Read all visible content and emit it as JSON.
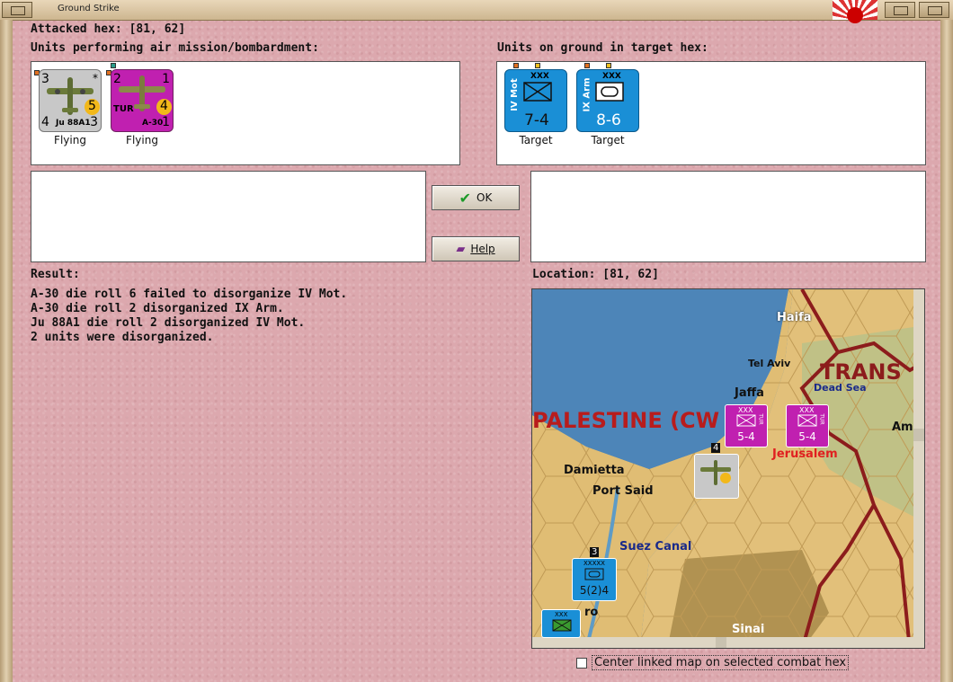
{
  "window": {
    "title": "Ground Strike"
  },
  "attacked_hex": {
    "label": "Attacked hex:",
    "value": "[81, 62]"
  },
  "air_units": {
    "label": "Units performing air mission/bombardment:",
    "units": [
      {
        "name": "Ju 88A1",
        "top_left": "3",
        "strength": "5",
        "bottom_left": "4",
        "bottom_right": "3",
        "star": "*",
        "status": "Flying",
        "color": "#c8c8c8"
      },
      {
        "name": "A-30",
        "nation": "TUR",
        "top_left": "2",
        "top_right": "1",
        "strength": "4",
        "bottom_right": "1",
        "status": "Flying",
        "color": "#c020b0"
      }
    ]
  },
  "ground_units": {
    "label": "Units on ground in target hex:",
    "units": [
      {
        "name": "IV Mot",
        "size": "XXX",
        "values": "7-4",
        "status": "Target",
        "color": "#1a8fd6"
      },
      {
        "name": "IX Arm",
        "size": "XXX",
        "values": "8-6",
        "status": "Target",
        "color": "#1a8fd6"
      }
    ]
  },
  "buttons": {
    "ok": "OK",
    "help": "Help"
  },
  "result": {
    "label": "Result:",
    "lines": [
      "A-30 die roll 6 failed to disorganize IV Mot.",
      "A-30 die roll 2 disorganized IX Arm.",
      "Ju 88A1 die roll 2 disorganized IV Mot.",
      "2 units were disorganized."
    ]
  },
  "location": {
    "label": "Location:",
    "value": "[81, 62]"
  },
  "map": {
    "places": [
      "Haifa",
      "Tel Aviv",
      "Jaffa",
      "Dead Sea",
      "TRANS",
      "Am",
      "PALESTINE (CW",
      "Jerusalem",
      "Damietta",
      "Port Said",
      "Suez Canal",
      "ro",
      "Sinai"
    ],
    "units": [
      {
        "size": "XXX",
        "values": "5-4",
        "nation": "TUR"
      },
      {
        "size": "XXX",
        "values": "5-4",
        "nation": "TUR"
      },
      {
        "size": "XXXXX",
        "values": "5(2)4"
      },
      {
        "size": "XXX"
      }
    ],
    "counts": [
      "4",
      "3"
    ]
  },
  "checkbox": {
    "label": "Center linked map on selected combat hex",
    "checked": false
  },
  "colors": {
    "background": "#dca8ae",
    "sea": "#4d85b8",
    "desert": "#e2c07a",
    "border": "#8c1c1c"
  }
}
